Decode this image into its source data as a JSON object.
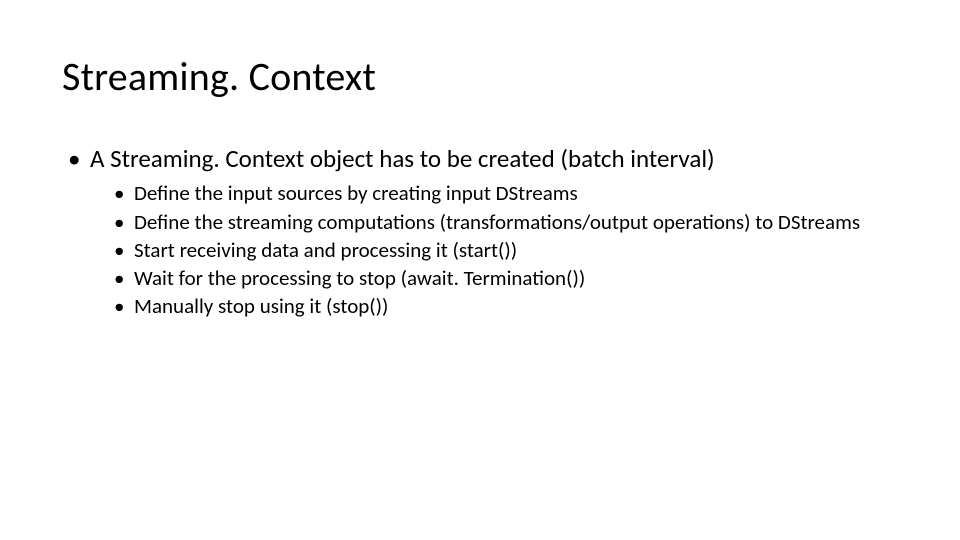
{
  "title": "Streaming. Context",
  "bullets": [
    {
      "text": "A Streaming. Context object has to be created (batch interval)",
      "sub": [
        "Define the input sources by creating input DStreams",
        "Define the streaming computations (transformations/output operations) to DStreams",
        "Start receiving data and processing it (start())",
        "Wait for the processing to stop (await. Termination())",
        "Manually stop using it (stop())"
      ]
    }
  ]
}
